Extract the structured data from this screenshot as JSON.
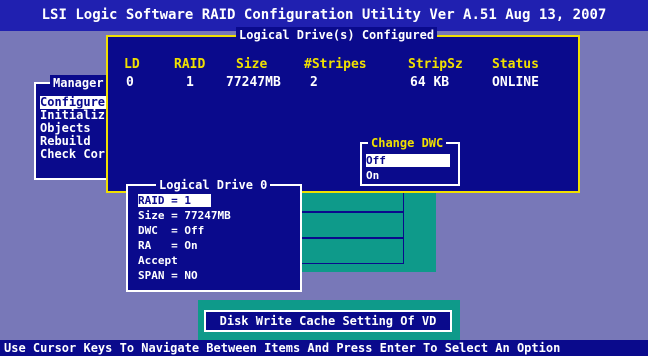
{
  "title": "LSI Logic Software RAID Configuration Utility Ver A.51 Aug 13, 2007",
  "status_bar": "Use Cursor Keys To Navigate Between Items And Press Enter To Select An Option",
  "management_menu": {
    "title": "Manager",
    "items": [
      "Configure",
      "Initializ",
      "Objects",
      "Rebuild",
      "Check Cor"
    ],
    "selected_index": 0
  },
  "logical_drives_configured": {
    "title": "Logical Drive(s) Configured",
    "columns": [
      "LD",
      "RAID",
      "Size",
      "#Stripes",
      "StripSz",
      "Status"
    ],
    "rows": [
      [
        "0",
        "1",
        "77247MB",
        "2",
        "64 KB",
        "ONLINE"
      ]
    ]
  },
  "change_dwc": {
    "title": "Change DWC",
    "options": [
      "Off",
      "On"
    ],
    "selected_index": 0
  },
  "logical_drive_0": {
    "title": "Logical Drive 0",
    "items": [
      "RAID = 1",
      "Size = 77247MB",
      "DWC  = Off",
      "RA   = On",
      "Accept",
      "SPAN = NO"
    ],
    "selected_index": 0
  },
  "hint": "Disk Write Cache Setting Of VD",
  "colors": {
    "background": "#7878b8",
    "panel": "#0a0a8c",
    "frame_yellow": "#f0e000",
    "teal": "#0e9a8a",
    "title_bar": "#2020b0"
  }
}
